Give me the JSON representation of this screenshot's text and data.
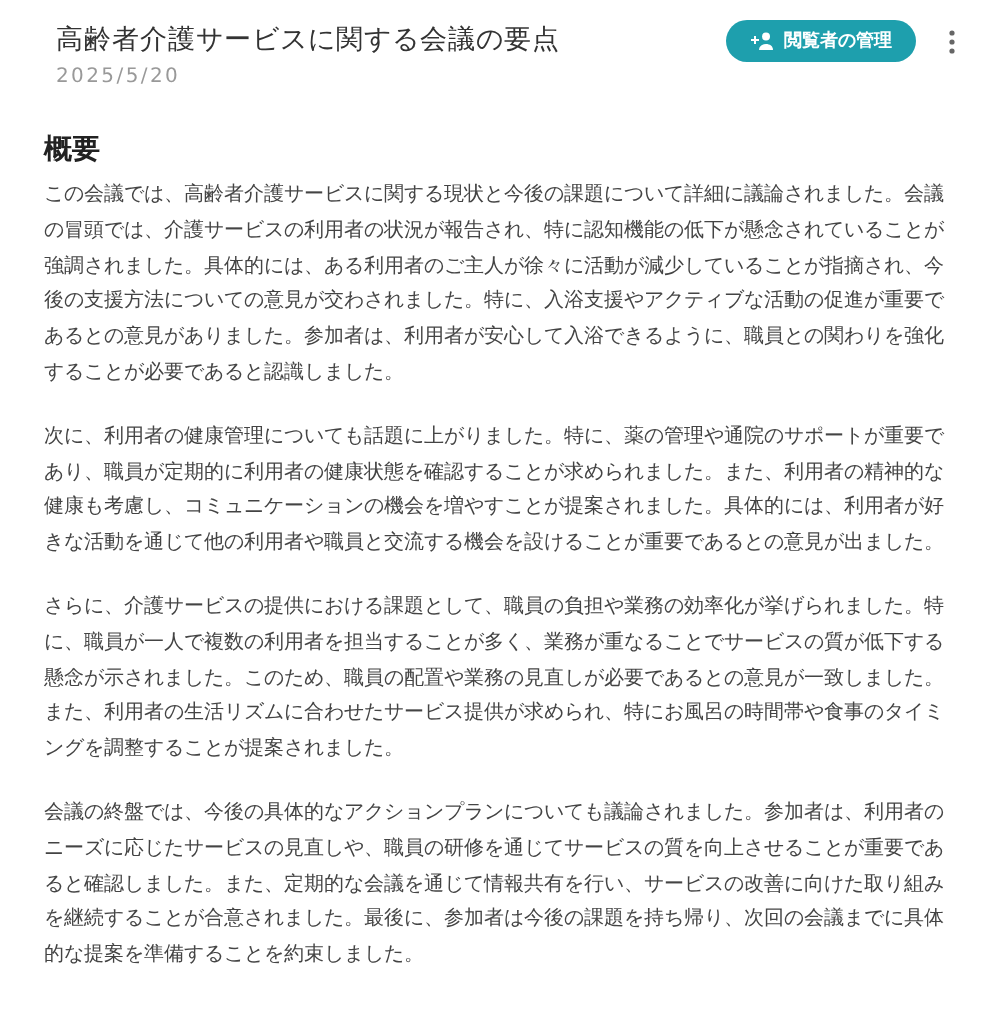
{
  "header": {
    "title": "高齢者介護サービスに関する会議の要点",
    "date": "2025/5/20",
    "manage_button": "閲覧者の管理"
  },
  "summary": {
    "heading": "概要",
    "paragraphs": [
      "この会議では、高齢者介護サービスに関する現状と今後の課題について詳細に議論されました。会議の冒頭では、介護サービスの利用者の状況が報告され、特に認知機能の低下が懸念されていることが強調されました。具体的には、ある利用者のご主人が徐々に活動が減少していることが指摘され、今後の支援方法についての意見が交わされました。特に、入浴支援やアクティブな活動の促進が重要であるとの意見がありました。参加者は、利用者が安心して入浴できるように、職員との関わりを強化することが必要であると認識しました。",
      "次に、利用者の健康管理についても話題に上がりました。特に、薬の管理や通院のサポートが重要であり、職員が定期的に利用者の健康状態を確認することが求められました。また、利用者の精神的な健康も考慮し、コミュニケーションの機会を増やすことが提案されました。具体的には、利用者が好きな活動を通じて他の利用者や職員と交流する機会を設けることが重要であるとの意見が出ました。",
      "さらに、介護サービスの提供における課題として、職員の負担や業務の効率化が挙げられました。特に、職員が一人で複数の利用者を担当することが多く、業務が重なることでサービスの質が低下する懸念が示されました。このため、職員の配置や業務の見直しが必要であるとの意見が一致しました。また、利用者の生活リズムに合わせたサービス提供が求められ、特にお風呂の時間帯や食事のタイミングを調整することが提案されました。",
      "会議の終盤では、今後の具体的なアクションプランについても議論されました。参加者は、利用者のニーズに応じたサービスの見直しや、職員の研修を通じてサービスの質を向上させることが重要であると確認しました。また、定期的な会議を通じて情報共有を行い、サービスの改善に向けた取り組みを継続することが合意されました。最後に、参加者は今後の課題を持ち帰り、次回の会議までに具体的な提案を準備することを約束しました。"
    ]
  }
}
